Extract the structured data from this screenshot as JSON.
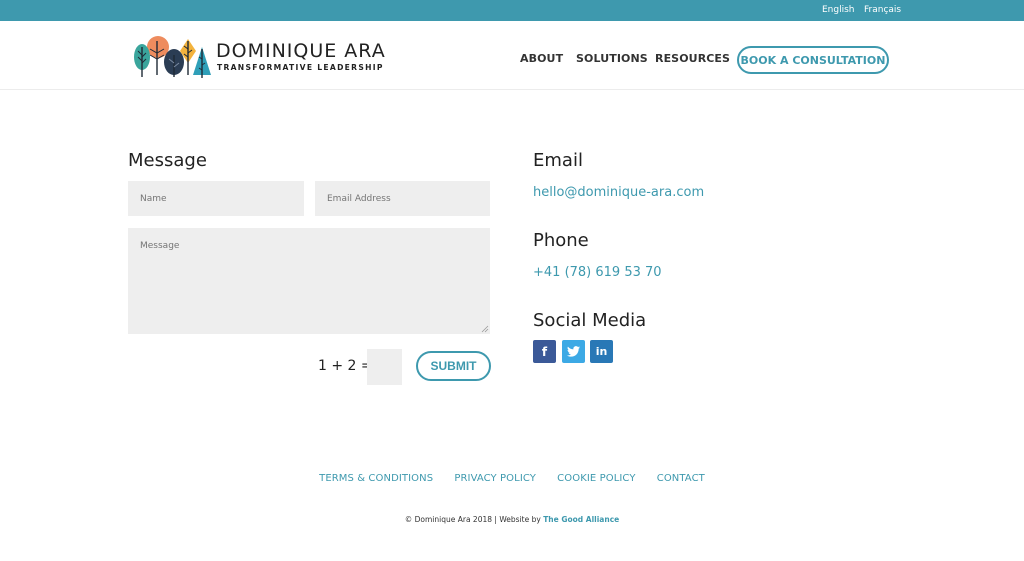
{
  "topbar": {
    "languages": [
      "English",
      "Français"
    ]
  },
  "header": {
    "logo": {
      "title": "DOMINIQUE ARA",
      "subtitle": "TRANSFORMATIVE LEADERSHIP"
    },
    "nav": [
      "ABOUT",
      "SOLUTIONS",
      "RESOURCES"
    ],
    "cta_label": "BOOK A CONSULTATION"
  },
  "contact_form": {
    "title": "Message",
    "name_placeholder": "Name",
    "email_placeholder": "Email Address",
    "message_placeholder": "Message",
    "captcha_question": "1 + 2 =",
    "captcha_value": "",
    "submit_label": "SUBMIT"
  },
  "contact_info": {
    "email_title": "Email",
    "email": "hello@dominique-ara.com",
    "phone_title": "Phone",
    "phone": "+41 (78) 619 53 70",
    "social_title": "Social Media",
    "social": [
      {
        "name": "facebook-icon",
        "glyph": "f"
      },
      {
        "name": "twitter-icon",
        "glyph": "t"
      },
      {
        "name": "linkedin-icon",
        "glyph": "in"
      }
    ]
  },
  "colors": {
    "accent": "#3e99ae",
    "facebook": "#3b5998",
    "twitter": "#3ca9e5",
    "linkedin": "#2978b6"
  },
  "footer": {
    "links": [
      "TERMS & CONDITIONS",
      "PRIVACY POLICY",
      "COOKIE POLICY",
      "CONTACT"
    ],
    "copyright": "© Dominique Ara 2018 | Website by ",
    "credit": "The Good Alliance"
  }
}
